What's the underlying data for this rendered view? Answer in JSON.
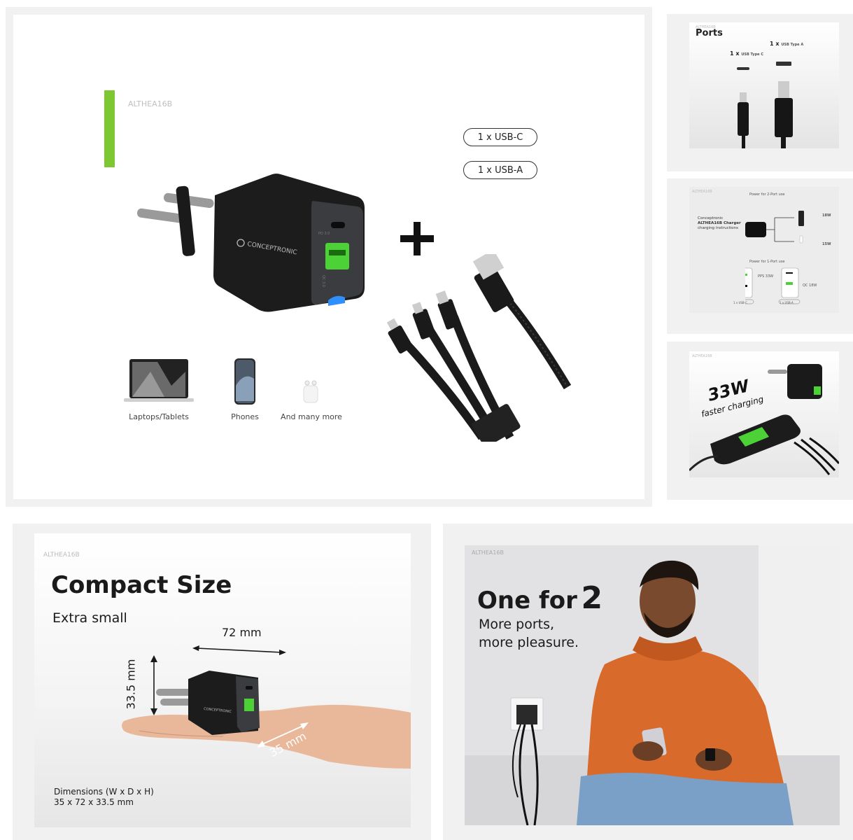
{
  "main_panel": {
    "model": "ALTHEA16B",
    "brand": "CONCEPTRONIC",
    "port_labels": [
      "PD 3.0",
      "QC 3.0"
    ],
    "pills": [
      "1 x USB-C",
      "1 x USB-A"
    ],
    "plus": "+",
    "devices": [
      {
        "label": "Laptops/Tablets",
        "icon": "laptop-icon"
      },
      {
        "label": "Phones",
        "icon": "phone-icon"
      },
      {
        "label": "And many more",
        "icon": "earbuds-icon"
      }
    ]
  },
  "thumb_ports": {
    "model": "ALTHEA16B",
    "title": "Ports",
    "usb_c_count": "1 x",
    "usb_c_label": "USB Type C",
    "usb_a_count": "1 x",
    "usb_a_label": "USB Type A"
  },
  "thumb_instructions": {
    "model": "ALTHEA16B",
    "two_port_heading": "Power for 2-Port use",
    "brand": "Conceptronic",
    "title": "ALTHEA16B Charger",
    "subtitle": "charging instructions",
    "w_top": "18W",
    "w_bottom": "15W",
    "one_port_heading": "Power for 1-Port use",
    "pps": "PPS 33W",
    "qc": "QC 18W",
    "usbc_tag": "1 x USB-C",
    "usba_tag": "1 x USB-A"
  },
  "thumb_33w": {
    "model": "ALTHEA16B",
    "headline": "33W",
    "subline": "faster charging"
  },
  "compact": {
    "model": "ALTHEA16B",
    "title": "Compact Size",
    "subtitle": "Extra small",
    "width_label": "72 mm",
    "height_label": "33.5 mm",
    "depth_label": "35 mm",
    "dims_title": "Dimensions (W x D x H)",
    "dims_value": "35 x 72 x 33.5 mm",
    "brand": "CONCEPTRONIC"
  },
  "one_for_two": {
    "model": "ALTHEA16B",
    "title_text": "One for",
    "title_number": "2",
    "line1": "More ports,",
    "line2": "more pleasure."
  }
}
